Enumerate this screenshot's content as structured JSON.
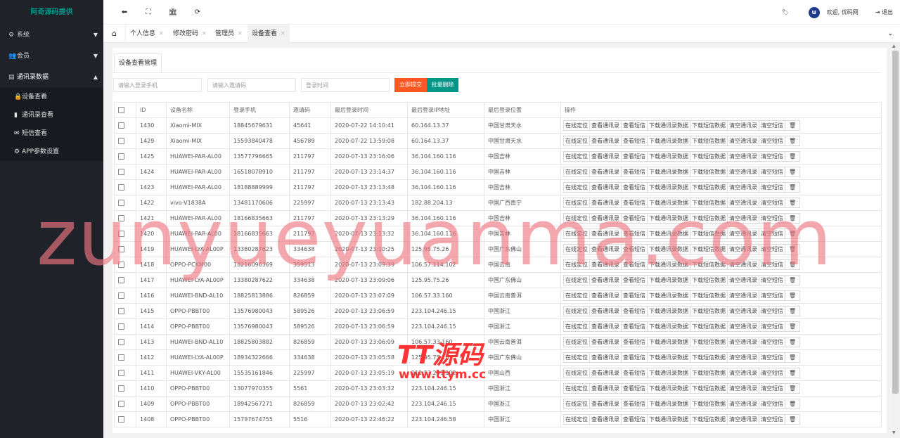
{
  "brand": "阿奇源码提供",
  "sidebar": {
    "items": [
      {
        "label": "系统",
        "icon": "gear-icon"
      },
      {
        "label": "会员",
        "icon": "users-icon"
      },
      {
        "label": "通讯录数据",
        "icon": "contacts-icon"
      }
    ],
    "sub_items": [
      {
        "label": "设备查看",
        "icon": "lock-icon"
      },
      {
        "label": "通讯录查看",
        "icon": "book-icon"
      },
      {
        "label": "短信查看",
        "icon": "envelope-icon"
      },
      {
        "label": "APP参数设置",
        "icon": "gear-icon"
      }
    ]
  },
  "header": {
    "welcome": "欢迎, 优码网",
    "logout": "退出",
    "avatar_letter": "u"
  },
  "tabs": [
    {
      "label": "个人信息"
    },
    {
      "label": "修改密码"
    },
    {
      "label": "管理员"
    },
    {
      "label": "设备查看"
    }
  ],
  "card": {
    "title": "设备查看管理"
  },
  "filters": {
    "phone_placeholder": "请输入登录手机",
    "invite_placeholder": "请输入邀请码",
    "time_placeholder": "登录时间",
    "submit_label": "立即提交",
    "batch_delete_label": "批量删除"
  },
  "table": {
    "columns": [
      "ID",
      "设备名称",
      "登录手机",
      "邀请码",
      "最后登录时间",
      "最后登录IP地址",
      "最后登录位置",
      "操作"
    ],
    "actions": [
      "在线定位",
      "查看通讯录",
      "查看短信",
      "下载通讯录数据",
      "下载短信数据",
      "清空通讯录",
      "清空短信"
    ],
    "rows": [
      {
        "id": "1430",
        "device": "Xiaomi-MIX",
        "phone": "18845679631",
        "invite": "45641",
        "time": "2020-07-22 14:10:41",
        "ip": "60.164.13.37",
        "location": "中国甘肃天水"
      },
      {
        "id": "1429",
        "device": "Xiaomi-MIX",
        "phone": "15593840478",
        "invite": "456789",
        "time": "2020-07-22 13:59:08",
        "ip": "60.164.13.37",
        "location": "中国甘肃天水"
      },
      {
        "id": "1425",
        "device": "HUAWEI-PAR-AL00",
        "phone": "13577796665",
        "invite": "211797",
        "time": "2020-07-13 23:16:06",
        "ip": "36.104.160.116",
        "location": "中国吉林"
      },
      {
        "id": "1424",
        "device": "HUAWEI-PAR-AL00",
        "phone": "16518078910",
        "invite": "211797",
        "time": "2020-07-13 23:14:37",
        "ip": "36.104.160.116",
        "location": "中国吉林"
      },
      {
        "id": "1423",
        "device": "HUAWEI-PAR-AL00",
        "phone": "18188889999",
        "invite": "211797",
        "time": "2020-07-13 23:13:48",
        "ip": "36.104.160.116",
        "location": "中国吉林"
      },
      {
        "id": "1422",
        "device": "vivo-V1838A",
        "phone": "13481170606",
        "invite": "225997",
        "time": "2020-07-13 23:13:43",
        "ip": "182.88.204.13",
        "location": "中国广西南宁"
      },
      {
        "id": "1421",
        "device": "HUAWEI-PAR-AL00",
        "phone": "18166835663",
        "invite": "211797",
        "time": "2020-07-13 23:13:29",
        "ip": "36.104.160.116",
        "location": "中国吉林"
      },
      {
        "id": "1420",
        "device": "HUAWEI-PAR-AL00",
        "phone": "18166835663",
        "invite": "211797",
        "time": "2020-07-13 23:13:32",
        "ip": "36.104.160.116",
        "location": "中国吉林"
      },
      {
        "id": "1419",
        "device": "HUAWEI-LYA-AL00P",
        "phone": "13380287623",
        "invite": "334638",
        "time": "2020-07-13 23:10:25",
        "ip": "125.95.75.26",
        "location": "中国广东佛山"
      },
      {
        "id": "1418",
        "device": "OPPO-PCKM00",
        "phone": "18216096369",
        "invite": "359513",
        "time": "2020-07-13 23:09:39",
        "ip": "106.57.114.102",
        "location": "中国云南"
      },
      {
        "id": "1417",
        "device": "HUAWEI-LYA-AL00P",
        "phone": "13380287622",
        "invite": "334638",
        "time": "2020-07-13 23:09:06",
        "ip": "125.95.75.26",
        "location": "中国广东佛山"
      },
      {
        "id": "1416",
        "device": "HUAWEI-BND-AL10",
        "phone": "18825813886",
        "invite": "826859",
        "time": "2020-07-13 23:07:09",
        "ip": "106.57.33.160",
        "location": "中国云南普洱"
      },
      {
        "id": "1415",
        "device": "OPPO-PBBT00",
        "phone": "13576980043",
        "invite": "589526",
        "time": "2020-07-13 23:06:59",
        "ip": "223.104.246.15",
        "location": "中国浙江"
      },
      {
        "id": "1414",
        "device": "OPPO-PBBT00",
        "phone": "13576980043",
        "invite": "589526",
        "time": "2020-07-13 23:06:59",
        "ip": "223.104.246.15",
        "location": "中国浙江"
      },
      {
        "id": "1413",
        "device": "HUAWEI-BND-AL10",
        "phone": "18825803882",
        "invite": "826859",
        "time": "2020-07-13 23:06:09",
        "ip": "106.57.33.160",
        "location": "中国云南普洱"
      },
      {
        "id": "1412",
        "device": "HUAWEI-LYA-AL00P",
        "phone": "18934322666",
        "invite": "334638",
        "time": "2020-07-13 23:05:58",
        "ip": "125.95.75.26",
        "location": "中国广东佛山"
      },
      {
        "id": "1411",
        "device": "HUAWEI-VKY-AL00",
        "phone": "15535161846",
        "invite": "225997",
        "time": "2020-07-13 23:05:19",
        "ip": "111.53.209.102",
        "location": "中国山西"
      },
      {
        "id": "1410",
        "device": "OPPO-PBBT00",
        "phone": "13077970355",
        "invite": "5561",
        "time": "2020-07-13 23:03:32",
        "ip": "223.104.246.15",
        "location": "中国浙江"
      },
      {
        "id": "1409",
        "device": "OPPO-PBBT00",
        "phone": "18942567271",
        "invite": "826859",
        "time": "2020-07-13 23:02:42",
        "ip": "223.104.246.15",
        "location": "中国浙江"
      },
      {
        "id": "1408",
        "device": "OPPO-PBBT00",
        "phone": "15797674755",
        "invite": "5516",
        "time": "2020-07-13 22:46:22",
        "ip": "223.104.246.58",
        "location": "中国浙江"
      }
    ]
  },
  "watermark": {
    "text": "zunyueyuanma.com",
    "logo_line1": "TT源码",
    "logo_line2": "www.ttym.cc"
  }
}
